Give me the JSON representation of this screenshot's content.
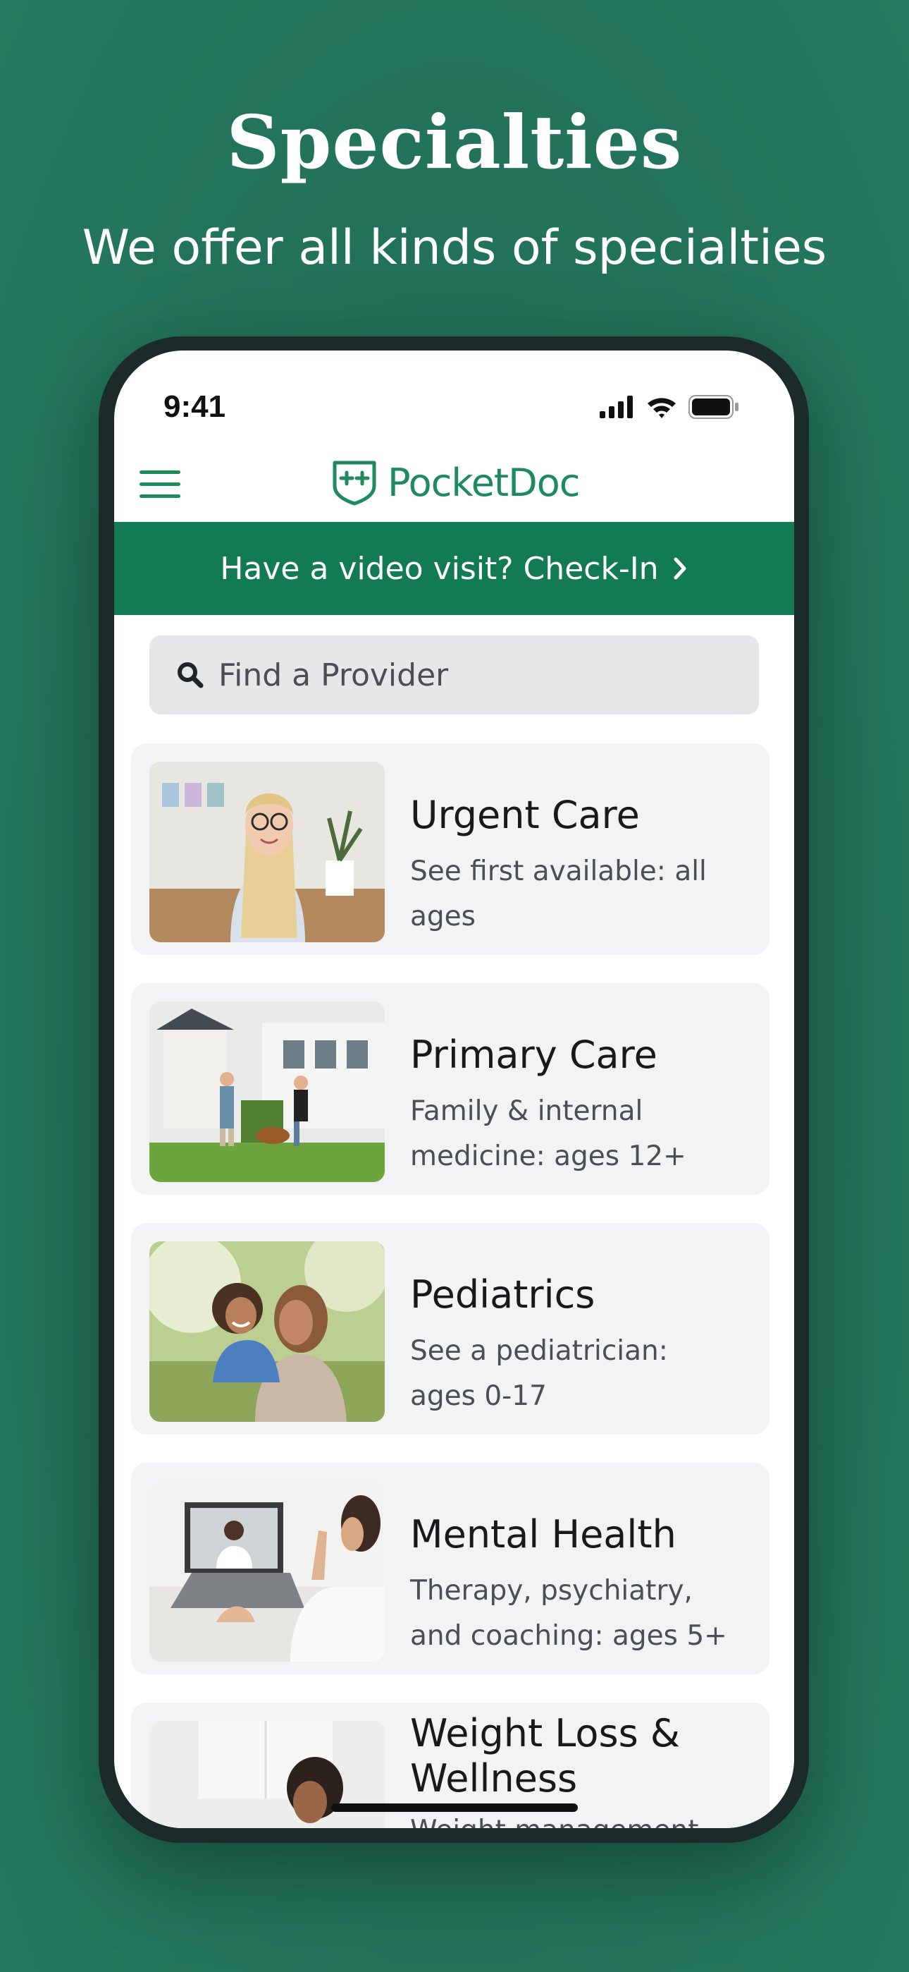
{
  "promo": {
    "title": "Specialties",
    "subtitle": "We offer all kinds of specialties"
  },
  "status_bar": {
    "time": "9:41",
    "icons": [
      "cellular-signal-icon",
      "wifi-icon",
      "battery-icon"
    ]
  },
  "header": {
    "menu_icon": "hamburger-menu-icon",
    "logo_icon": "medical-shield-icon",
    "logo_text": "PocketDoc"
  },
  "checkin_banner": {
    "label": "Have a video visit? Check-In",
    "icon": "chevron-right-icon"
  },
  "search": {
    "icon": "search-icon",
    "placeholder": "Find a Provider"
  },
  "specialties": [
    {
      "title": "Urgent Care",
      "description": "See first available: all ages",
      "photo": "smiling-woman-glasses-photo"
    },
    {
      "title": "Primary Care",
      "description": "Family & internal medicine: ages 12+",
      "photo": "family-yard-dog-photo"
    },
    {
      "title": "Pediatrics",
      "description": "See a pediatrician: ages 0-17",
      "photo": "mother-child-piggyback-photo"
    },
    {
      "title": "Mental Health",
      "description": "Therapy, psychiatry, and coaching: ages 5+",
      "photo": "video-call-laptop-photo"
    },
    {
      "title": "Weight Loss & Wellness",
      "description": "Weight management",
      "photo": "woman-kitchen-photo"
    }
  ],
  "colors": {
    "background": "#247358",
    "brand_green": "#1e8a5e",
    "banner_green": "#137b54",
    "card_bg": "#f2f3f5",
    "search_bg": "#e6e7e9"
  }
}
